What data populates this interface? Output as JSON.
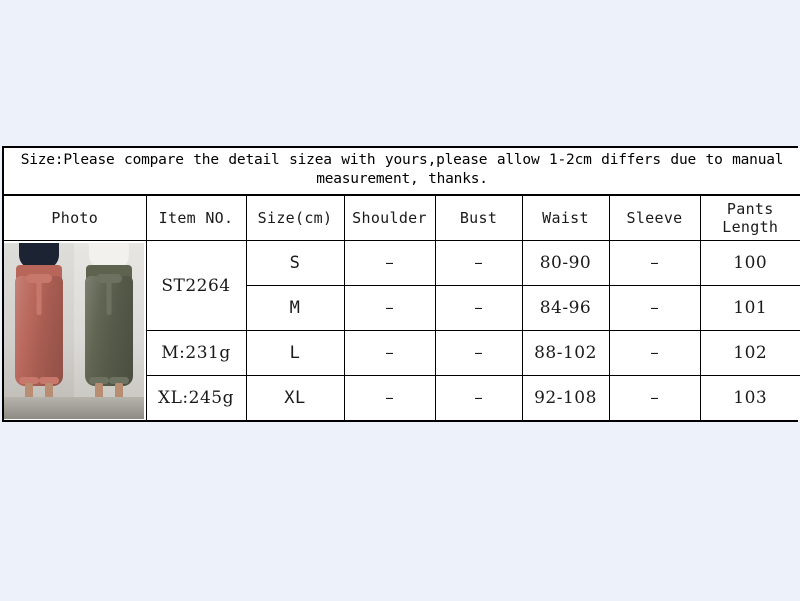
{
  "background_color": "#edf1f9",
  "chart": {
    "notice": "Size:Please compare the detail sizea with yours,please allow 1-2cm differs due to manual measurement, thanks.",
    "columns": [
      "Photo",
      "Item NO.",
      "Size(cm)",
      "Shoulder",
      "Bust",
      "Waist",
      "Sleeve",
      "Pants Length"
    ],
    "photo": {
      "alt": "Two models wearing high-waisted paperbag tie-belt pants",
      "left_color": "#b9665a",
      "right_color": "#5e6350",
      "left_top_color": "#1c2333",
      "right_top_color": "#f2f1ee"
    },
    "item_no": {
      "style_code": "ST2264",
      "weight_m": "M:231g",
      "weight_xl": "XL:245g"
    },
    "rows": [
      {
        "size": "S",
        "shoulder": "–",
        "bust": "–",
        "waist": "80-90",
        "sleeve": "–",
        "pants_length": "100"
      },
      {
        "size": "M",
        "shoulder": "–",
        "bust": "–",
        "waist": "84-96",
        "sleeve": "–",
        "pants_length": "101"
      },
      {
        "size": "L",
        "shoulder": "–",
        "bust": "–",
        "waist": "88-102",
        "sleeve": "–",
        "pants_length": "102"
      },
      {
        "size": "XL",
        "shoulder": "–",
        "bust": "–",
        "waist": "92-108",
        "sleeve": "–",
        "pants_length": "103"
      }
    ]
  }
}
